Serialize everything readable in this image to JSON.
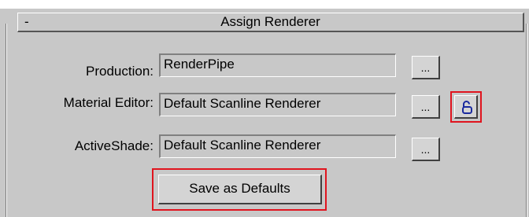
{
  "rollout": {
    "title": "Assign Renderer",
    "collapse_symbol": "-"
  },
  "production": {
    "label": "Production:",
    "value": "RenderPipe",
    "browse_label": "..."
  },
  "material_editor": {
    "label": "Material Editor:",
    "value": "Default Scanline Renderer",
    "browse_label": "...",
    "lock_icon": "lock-icon"
  },
  "activeshade": {
    "label": "ActiveShade:",
    "value": "Default Scanline Renderer",
    "browse_label": "..."
  },
  "save_defaults": {
    "label": "Save as Defaults"
  },
  "colors": {
    "panel_bg": "#c8c8c8",
    "highlight": "#e0141e",
    "lock_icon": "#1a2a9e"
  }
}
